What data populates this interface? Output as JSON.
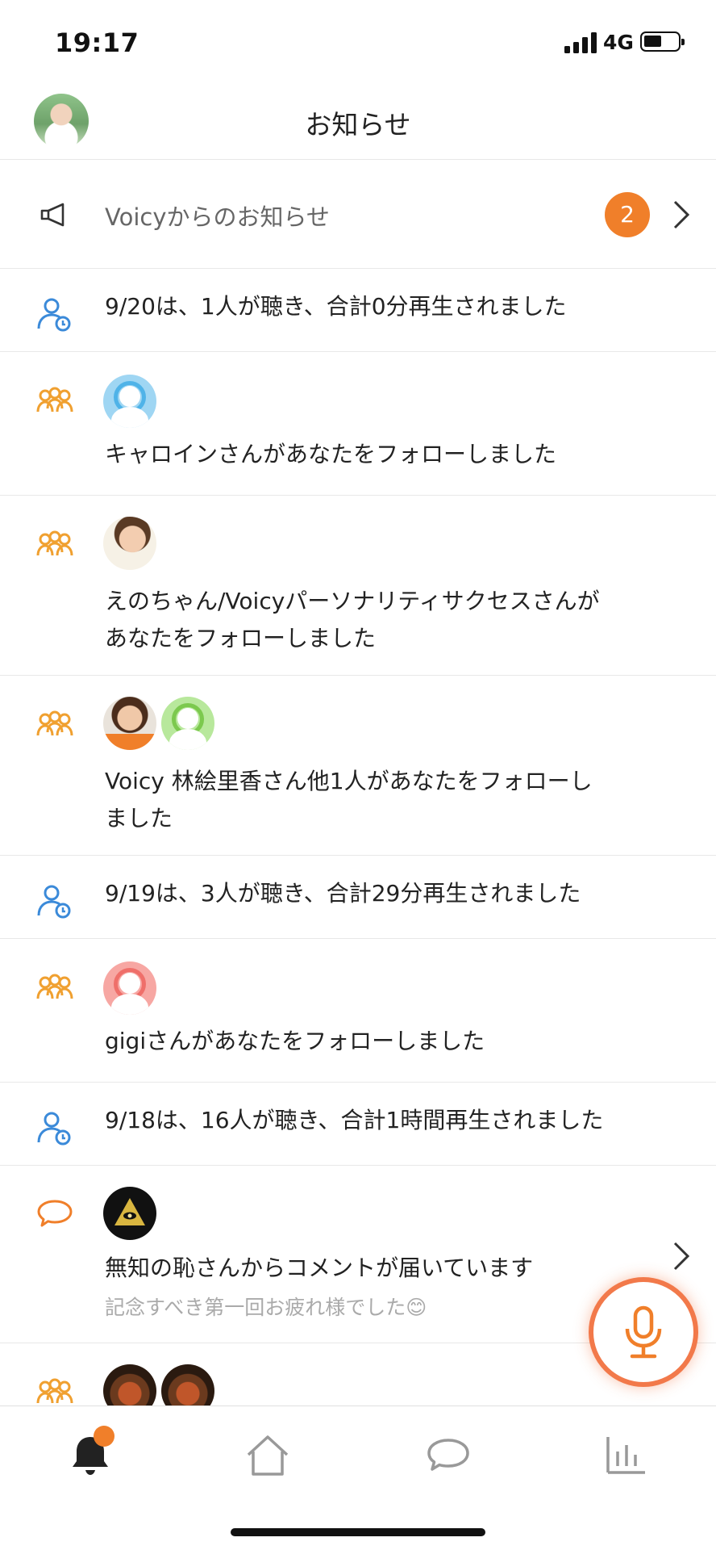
{
  "status_bar": {
    "time": "19:17",
    "network": "4G"
  },
  "header": {
    "title": "お知らせ"
  },
  "announcement": {
    "label": "Voicyからのお知らせ",
    "badge_count": "2"
  },
  "notifications": [
    {
      "type": "stats",
      "text": "9/20は、1人が聴き、合計0分再生されました"
    },
    {
      "type": "follow",
      "text": "キャロインさんがあなたをフォローしました"
    },
    {
      "type": "follow",
      "text_line1": "えのちゃん/Voicyパーソナリティサクセスさんが",
      "text_line2": "あなたをフォローしました"
    },
    {
      "type": "follow",
      "text_line1": "Voicy 林絵里香さん他1人があなたをフォローし",
      "text_line2": "ました"
    },
    {
      "type": "stats",
      "text": "9/19は、3人が聴き、合計29分再生されました"
    },
    {
      "type": "follow",
      "text": "gigiさんがあなたをフォローしました"
    },
    {
      "type": "stats",
      "text": "9/18は、16人が聴き、合計1時間再生されました"
    },
    {
      "type": "comment",
      "text": "無知の恥さんからコメントが届いています",
      "sub": "記念すべき第一回お疲れ様でした😊"
    },
    {
      "type": "follow",
      "text": ""
    }
  ],
  "colors": {
    "accent": "#f07f2a",
    "stats_icon": "#3b8ad9",
    "follow_icon": "#f0a030"
  },
  "tabbar": {
    "tabs": [
      "bell-icon",
      "home-icon",
      "chat-icon",
      "chart-icon"
    ],
    "active": "bell-icon"
  }
}
